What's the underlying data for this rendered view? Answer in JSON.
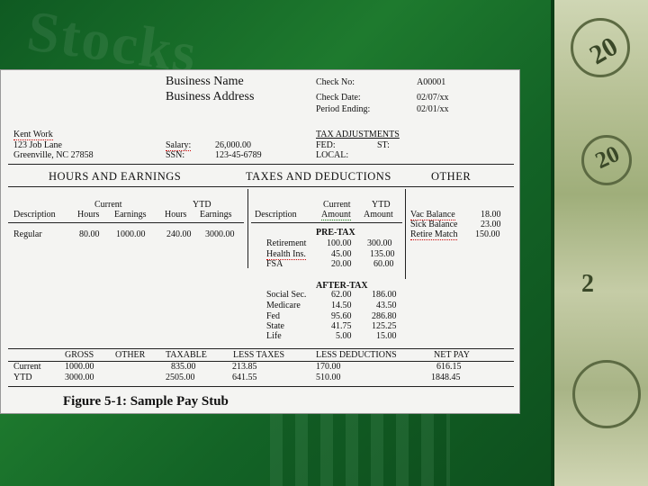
{
  "background": {
    "watermark": "Stocks"
  },
  "employer": {
    "name": "Business Name",
    "address": "Business Address"
  },
  "check": {
    "no_label": "Check No:",
    "no": "A00001",
    "date_label": "Check Date:",
    "date": "02/07/xx",
    "period_label": "Period Ending:",
    "period": "02/01/xx"
  },
  "employee": {
    "name": "Kent Work",
    "street": "123 Job Lane",
    "city": "Greenville, NC 27858",
    "salary_label": "Salary:",
    "salary": "26,000.00",
    "ssn_label": "SSN:",
    "ssn": "123-45-6789"
  },
  "tax_adj": {
    "title": "TAX ADJUSTMENTS",
    "fed": "FED:",
    "st": "ST:",
    "local": "LOCAL:"
  },
  "sections": {
    "hours": "HOURS AND EARNINGS",
    "taxes": "TAXES AND DEDUCTIONS",
    "other": "OTHER"
  },
  "earnings": {
    "col_description": "Description",
    "current": "Current",
    "ytd": "YTD",
    "hours": "Hours",
    "earnings": "Earnings",
    "row": {
      "desc": "Regular",
      "cur_hours": "80.00",
      "cur_earn": "1000.00",
      "ytd_hours": "240.00",
      "ytd_earn": "3000.00"
    }
  },
  "deductions": {
    "col_description": "Description",
    "current": "Current",
    "ytd": "YTD",
    "amount": "Amount",
    "pretax_title": "PRE-TAX",
    "pretax": [
      {
        "name": "Retirement",
        "cur": "100.00",
        "ytd": "300.00"
      },
      {
        "name": "Health Ins.",
        "cur": "45.00",
        "ytd": "135.00"
      },
      {
        "name": "FSA",
        "cur": "20.00",
        "ytd": "60.00"
      }
    ],
    "aftertax_title": "AFTER-TAX",
    "aftertax": [
      {
        "name": "Social Sec.",
        "cur": "62.00",
        "ytd": "186.00"
      },
      {
        "name": "Medicare",
        "cur": "14.50",
        "ytd": "43.50"
      },
      {
        "name": "Fed",
        "cur": "95.60",
        "ytd": "286.80"
      },
      {
        "name": "State",
        "cur": "41.75",
        "ytd": "125.25"
      },
      {
        "name": "Life",
        "cur": "5.00",
        "ytd": "15.00"
      }
    ]
  },
  "other": [
    {
      "label": "Vac Balance",
      "value": "18.00"
    },
    {
      "label": "Sick Balance",
      "value": "23.00"
    },
    {
      "label": "Retire Match",
      "value": "150.00"
    }
  ],
  "totals": {
    "headers": {
      "gross": "GROSS",
      "other": "OTHER",
      "taxable": "TAXABLE",
      "less_taxes": "LESS TAXES",
      "less_deductions": "LESS DEDUCTIONS",
      "net_pay": "NET PAY"
    },
    "current": {
      "label": "Current",
      "gross": "1000.00",
      "taxable": "835.00",
      "less_taxes": "213.85",
      "less_deductions": "170.00",
      "net_pay": "616.15"
    },
    "ytd": {
      "label": "YTD",
      "gross": "3000.00",
      "taxable": "2505.00",
      "less_taxes": "641.55",
      "less_deductions": "510.00",
      "net_pay": "1848.45"
    }
  },
  "caption": "Figure 5-1:  Sample Pay Stub"
}
